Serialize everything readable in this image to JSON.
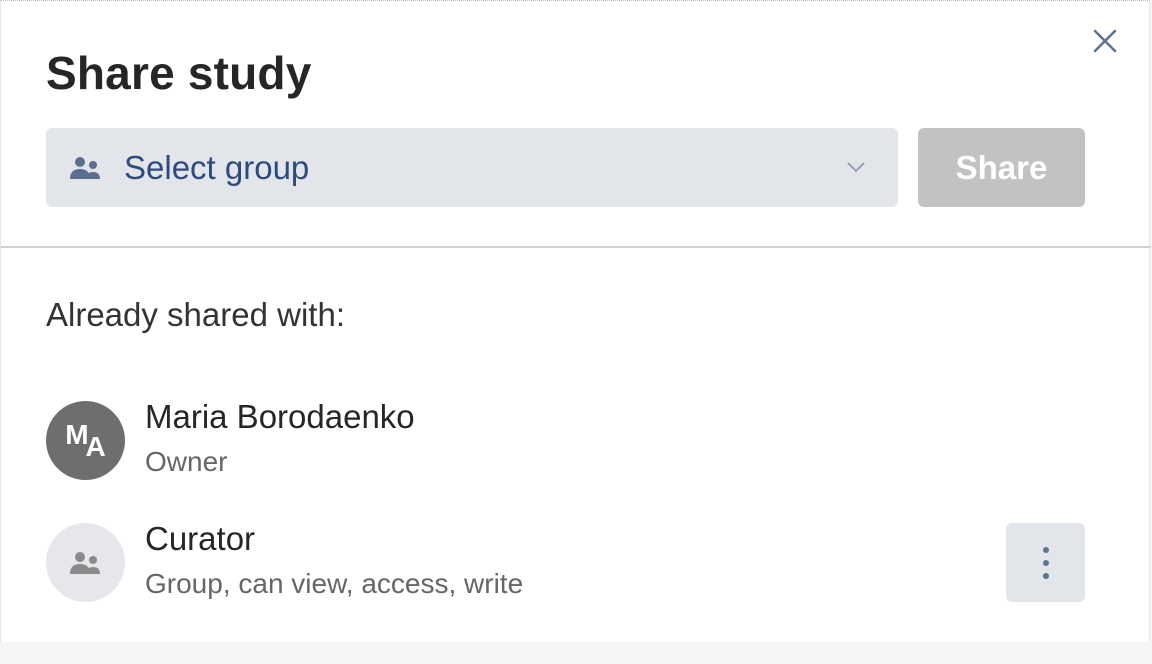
{
  "dialog": {
    "title": "Share study",
    "close_icon": "close-icon"
  },
  "share_form": {
    "select_placeholder": "Select group",
    "select_icon": "group-icon",
    "dropdown_icon": "chevron-down-icon",
    "share_label": "Share"
  },
  "shared": {
    "heading": "Already shared with:",
    "entries": [
      {
        "initials_1": "M",
        "initials_2": "A",
        "name": "Maria Borodaenko",
        "role": "Owner",
        "avatar_type": "user"
      },
      {
        "name": "Curator",
        "role": "Group, can view, access, write",
        "avatar_type": "group",
        "menu_icon": "more-vertical-icon"
      }
    ]
  },
  "colors": {
    "title": "#262626",
    "select_bg": "#e2e5ea",
    "select_text": "#2f4b7c",
    "share_disabled": "#c2c2c2",
    "user_avatar": "#6e6e6e"
  }
}
